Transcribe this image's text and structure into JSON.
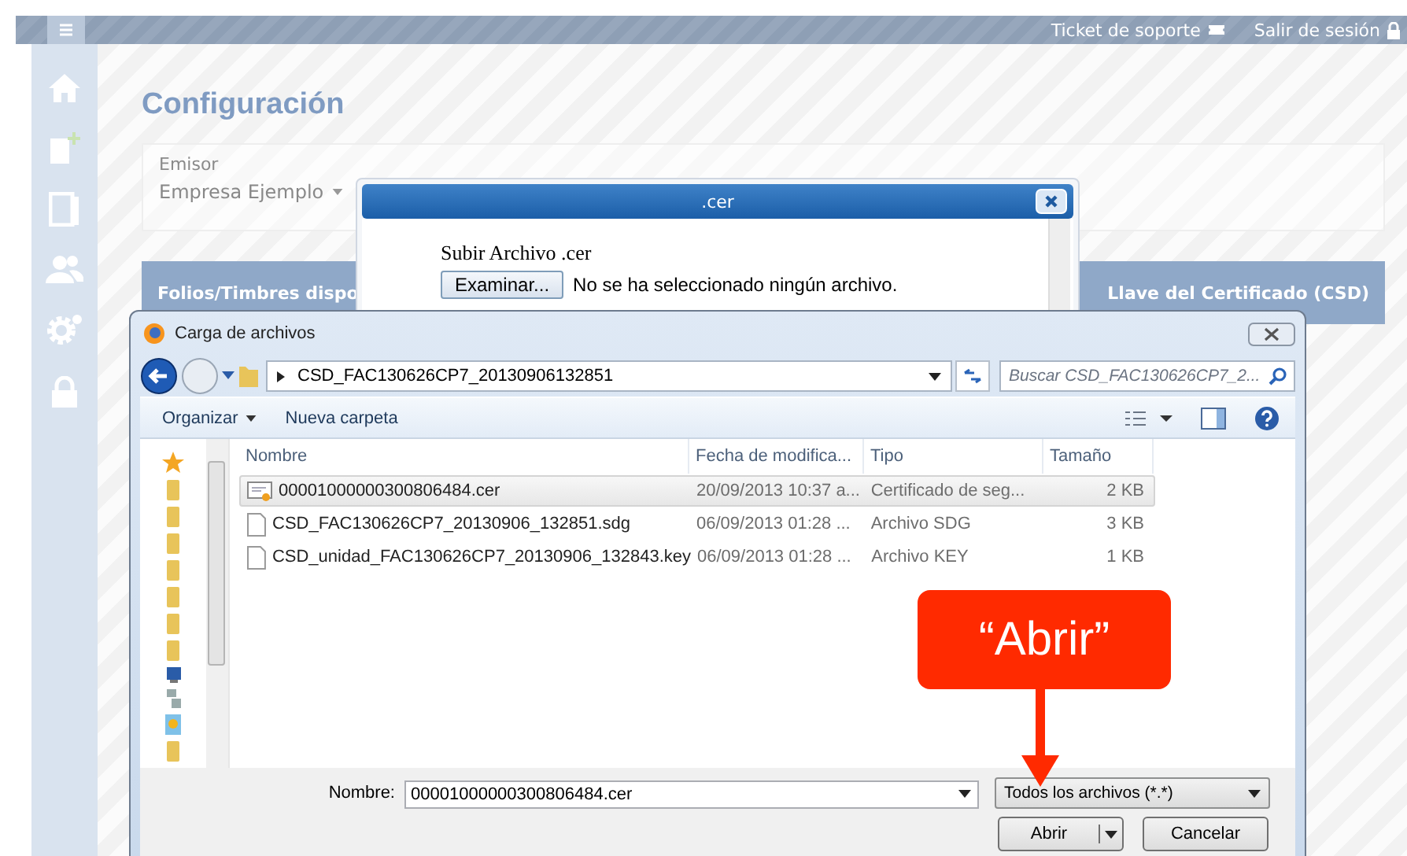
{
  "topbar": {
    "links": [
      {
        "label": "Ticket de soporte",
        "kind": "ticket"
      },
      {
        "label": "Salir de sesión",
        "kind": "logout"
      }
    ]
  },
  "page": {
    "title": "Configuración",
    "emisor": {
      "label": "Emisor",
      "value": "Empresa Ejemplo"
    },
    "section_bar": {
      "left": "Folios/Timbres dispo",
      "right": "Llave del Certificado (CSD)"
    }
  },
  "upload_modal": {
    "title": ".cer",
    "heading": "Subir Archivo .cer",
    "browse_button": "Examinar...",
    "file_status": "No se ha seleccionado ningún archivo."
  },
  "file_dialog": {
    "title": "Carga de archivos",
    "path": "CSD_FAC130626CP7_20130906132851",
    "search": {
      "placeholder": "Buscar CSD_FAC130626CP7_2..."
    },
    "toolbar": [
      "Organizar",
      "Nueva carpeta"
    ],
    "columns": [
      "Nombre",
      "Fecha de modifica...",
      "Tipo",
      "Tamaño"
    ],
    "rows": [
      {
        "kind": "certificate",
        "selected": true,
        "cells": [
          "00001000000300806484.cer",
          "20/09/2013 10:37 a...",
          "Certificado de seg...",
          "2 KB"
        ]
      },
      {
        "kind": "file",
        "selected": false,
        "cells": [
          "CSD_FAC130626CP7_20130906_132851.sdg",
          "06/09/2013 01:28 ...",
          "Archivo SDG",
          "3 KB"
        ]
      },
      {
        "kind": "file",
        "selected": false,
        "cells": [
          "CSD_unidad_FAC130626CP7_20130906_132843.key",
          "06/09/2013 01:28 ...",
          "Archivo KEY",
          "1 KB"
        ]
      }
    ],
    "filename_label": "Nombre:",
    "filename": "00001000000300806484.cer",
    "filter": "Todos los archivos (*.*)",
    "buttons": [
      "Abrir",
      "Cancelar"
    ]
  },
  "callout": {
    "text": "“Abrir”"
  }
}
